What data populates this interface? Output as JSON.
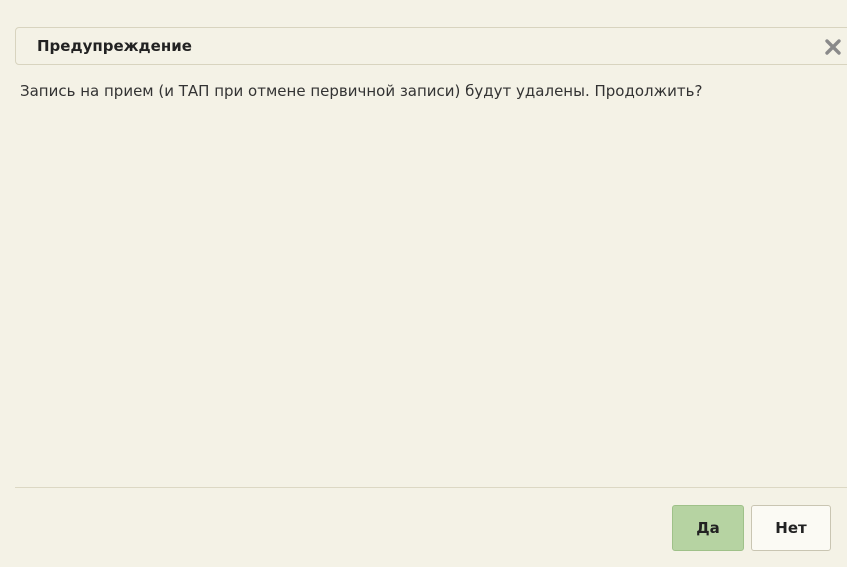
{
  "dialog": {
    "title": "Предупреждение",
    "close_icon": "close-icon",
    "message": "Запись на прием (и ТАП при отмене первичной записи) будут удалены. Продолжить?",
    "buttons": {
      "yes_label": "Да",
      "no_label": "Нет"
    }
  },
  "colors": {
    "background": "#f4f2e6",
    "primary_button": "#b6d3a2",
    "secondary_button": "#fbfaf4",
    "close_icon": "#8a8a8a"
  }
}
